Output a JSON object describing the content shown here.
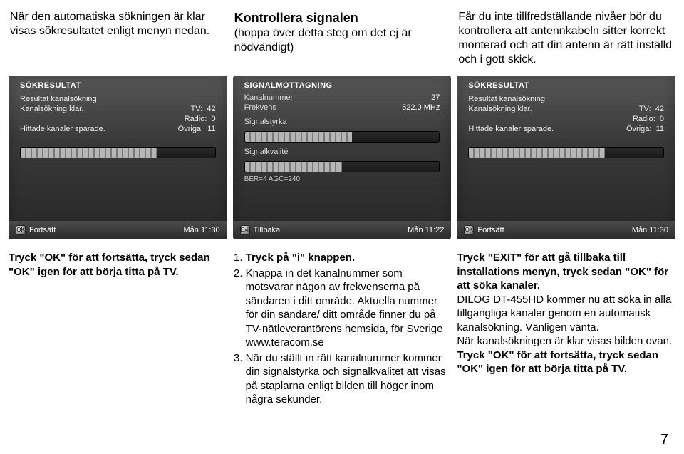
{
  "columns": [
    {
      "header_plain": "När den automatiska sökningen är klar visas sökresultatet enligt menyn nedan.",
      "screenshot": {
        "title": "SÖKRESULTAT",
        "lines": [
          {
            "l": "Resultat kanalsökning",
            "r": ""
          },
          {
            "l": "Kanalsökning klar.",
            "r": ""
          }
        ],
        "stats": [
          {
            "l": "TV:",
            "r": "42"
          },
          {
            "l": "Radio:",
            "r": "0"
          },
          {
            "l": "Övriga:",
            "r": "11"
          }
        ],
        "bottom_left": "Fortsätt",
        "bottom_left_btn": "OK",
        "bottom_right": "Mån 11:30",
        "notice": "Hittade kanaler sparade."
      },
      "footer": "Tryck \"OK\" för att fortsätta, tryck sedan \"OK\" igen för att börja titta på TV."
    },
    {
      "header_title": "Kontrollera signalen",
      "header_sub": "(hoppa över detta steg om det ej är nödvändigt)",
      "screenshot": {
        "title": "SIGNALMOTTAGNING",
        "rows": [
          {
            "l": "Kanalnummer",
            "r": "27"
          },
          {
            "l": "Frekvens",
            "r": "522.0 MHz"
          }
        ],
        "labels": [
          "Signalstyrka",
          "Signalkvalité"
        ],
        "ber": "BER=4 AGC=240",
        "bottom_left": "Tillbaka",
        "bottom_left_btn": "Exit",
        "bottom_right": "Mån 11:22"
      },
      "steps": [
        "Tryck på \"i\" knappen.",
        "Knappa in det kanalnummer som motsvarar någon av frekvenserna på sändaren i ditt område. Aktuella nummer för din sändare/ ditt område finner du på TV-nätleverantörens hemsida, för Sverige www.teracom.se",
        "När du ställt in rätt kanalnummer kommer din signalstyrka och signalkvalitet att visas på staplarna enligt bilden till höger inom några sekunder."
      ]
    },
    {
      "header_plain": "Får du inte tillfredställande nivåer bör du kontrollera att antennkabeln sitter korrekt monterad och att din antenn är rätt inställd och i gott skick.",
      "screenshot": {
        "title": "SÖKRESULTAT",
        "lines": [
          {
            "l": "Resultat kanalsökning",
            "r": ""
          },
          {
            "l": "Kanalsökning klar.",
            "r": ""
          }
        ],
        "stats": [
          {
            "l": "TV:",
            "r": "42"
          },
          {
            "l": "Radio:",
            "r": "0"
          },
          {
            "l": "Övriga:",
            "r": "11"
          }
        ],
        "bottom_left": "Fortsätt",
        "bottom_left_btn": "OK",
        "bottom_right": "Mån 11:30",
        "notice": "Hittade kanaler sparade."
      },
      "footer_html": {
        "p1": "Tryck \"EXIT\" för att gå tillbaka till installations menyn, tryck sedan \"OK\" för att söka kanaler.",
        "p2": "DILOG DT-455HD kommer nu att söka in alla tillgängliga kanaler genom en automatisk kanalsökning. Vänligen vänta.",
        "p3": "När kanalsökningen är klar visas bilden ovan.",
        "p4": "Tryck \"OK\" för att fortsätta, tryck sedan \"OK\" igen för att börja titta på TV."
      }
    }
  ],
  "page_number": "7"
}
